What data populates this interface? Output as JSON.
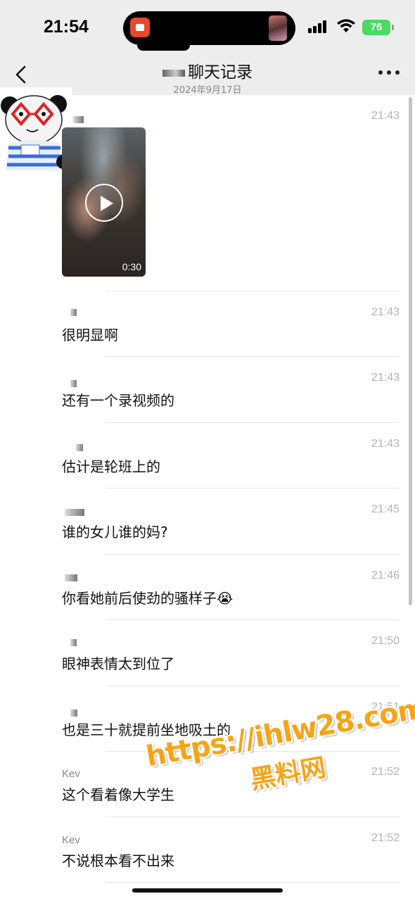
{
  "status_bar": {
    "time": "21:54",
    "battery": "76",
    "battery_color": "#4cd964",
    "icons": [
      "app-icon",
      "cellular-signal-icon",
      "wifi-icon",
      "battery-icon"
    ]
  },
  "nav": {
    "title": "聊天记录",
    "date": "2024年9月17日",
    "back_icon": "chevron-left-icon",
    "more_icon": "more-dots-icon"
  },
  "video_message": {
    "time": "21:43",
    "duration": "0:30",
    "play_icon": "play-icon"
  },
  "messages": [
    {
      "sender": "",
      "time": "21:43",
      "text": "很明显啊"
    },
    {
      "sender": "",
      "time": "21:43",
      "text": "还有一个录视频的"
    },
    {
      "sender": "",
      "time": "21:43",
      "text": "估计是轮班上的"
    },
    {
      "sender": "",
      "time": "21:45",
      "text": "谁的女儿谁的妈?"
    },
    {
      "sender": "",
      "time": "21:46",
      "text": "你看她前后使劲的骚样子😭"
    },
    {
      "sender": "",
      "time": "21:50",
      "text": "眼神表情太到位了"
    },
    {
      "sender": "",
      "time": "21:51",
      "text": "也是三十就提前坐地吸土的"
    },
    {
      "sender": "Kev",
      "time": "21:52",
      "text": "这个看着像大学生"
    },
    {
      "sender": "Kev",
      "time": "21:52",
      "text": "不说根本看不出来"
    }
  ],
  "watermark": {
    "url": "https://ihlw28.com",
    "site": "黑料网"
  }
}
